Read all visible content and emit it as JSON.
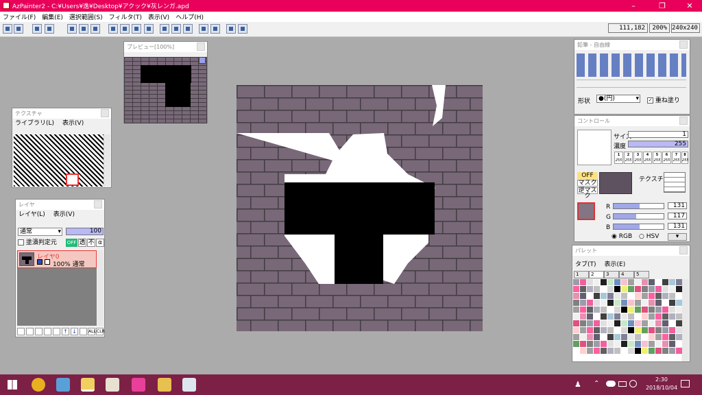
{
  "window": {
    "title": "AzPainter2 - C:¥Users¥逸¥Desktop¥アクック¥灰レンガ.apd"
  },
  "menu": [
    "ファイル(F)",
    "編集(E)",
    "選択範囲(S)",
    "フィルタ(T)",
    "表示(V)",
    "ヘルプ(H)"
  ],
  "status": {
    "coords": "111,182",
    "zoom": "200%",
    "size": "240x240"
  },
  "preview": {
    "title": "プレビュー[100%]"
  },
  "texture": {
    "title": "テクスチャ",
    "menu": [
      "ライブラリ(L)",
      "表示(V)"
    ]
  },
  "layer": {
    "title": "レイヤ",
    "menu": [
      "レイヤ(L)",
      "表示(V)"
    ],
    "blend": "通常",
    "opacity": "100",
    "fill_check": "塗潰判定元",
    "off": "OFF",
    "toggle_trans": "透",
    "toggle_not": "不",
    "toggle_alpha": "α",
    "layer_name": "レイヤ0",
    "layer_info": "100% 通常",
    "buttons": [
      "ALL",
      "CLR"
    ]
  },
  "brush": {
    "title": "鉛筆 - 自由線",
    "shape_label": "形状",
    "shape_value": "●(円)",
    "overwrite": "重ね塗り"
  },
  "control": {
    "title": "コントロール",
    "size_label": "サイズ",
    "size_value": "1",
    "density_label": "濃度",
    "density_value": "255",
    "presets": [
      "1",
      "2",
      "3",
      "4",
      "5",
      "6",
      "7",
      "8"
    ],
    "preset_vals": [
      "255",
      "255",
      "255",
      "255",
      "255",
      "255",
      "255",
      "255"
    ],
    "off": "OFF",
    "mask": "マスク",
    "inverse_mask": "逆マスク",
    "texture_label": "テクスチャ",
    "r_label": "R",
    "g_label": "G",
    "b_label": "B",
    "r": "131",
    "g": "117",
    "b": "131",
    "rgb": "RGB",
    "hsv": "HSV"
  },
  "palette": {
    "title": "パレット",
    "menu": [
      "タブ(T)",
      "表示(E)"
    ],
    "tabs": [
      "1",
      "2",
      "3",
      "4",
      "5"
    ]
  },
  "taskbar": {
    "time": "2:30",
    "date": "2018/10/04"
  },
  "colors": {
    "brick": "#786878",
    "mortar": "#413d41",
    "accent": "#e8005a",
    "taskbar": "#7c2046"
  }
}
